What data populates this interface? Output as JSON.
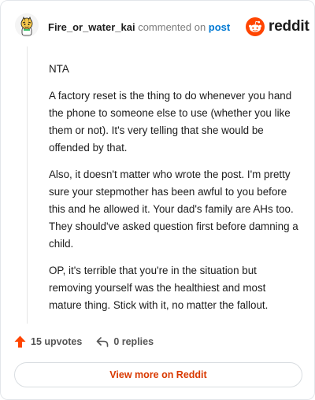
{
  "comment": {
    "username": "Fire_or_water_kai",
    "action_text": " commented on ",
    "post_link": "post",
    "paragraphs": [
      "NTA",
      "A factory reset is the thing to do whenever you hand the phone to someone else to use (whether you like them or not). It's very telling that she would be offended by that.",
      "Also, it doesn't matter who wrote the post. I'm pretty sure your stepmother has been awful to you before this and he allowed it. Your dad's family are AHs too. They should've asked question first before damning a child.",
      "OP, it's terrible that you're in the situation but removing yourself was the healthiest and most mature thing. Stick with it, no matter the fallout."
    ]
  },
  "brand": {
    "name": "reddit",
    "color": "#ff4500"
  },
  "actions": {
    "upvotes": "15 upvotes",
    "replies": "0 replies",
    "upvote_icon": "arrow-up-icon",
    "reply_icon": "reply-arrow-icon"
  },
  "footer": {
    "view_more": "View more on Reddit",
    "accent": "#d93900"
  }
}
